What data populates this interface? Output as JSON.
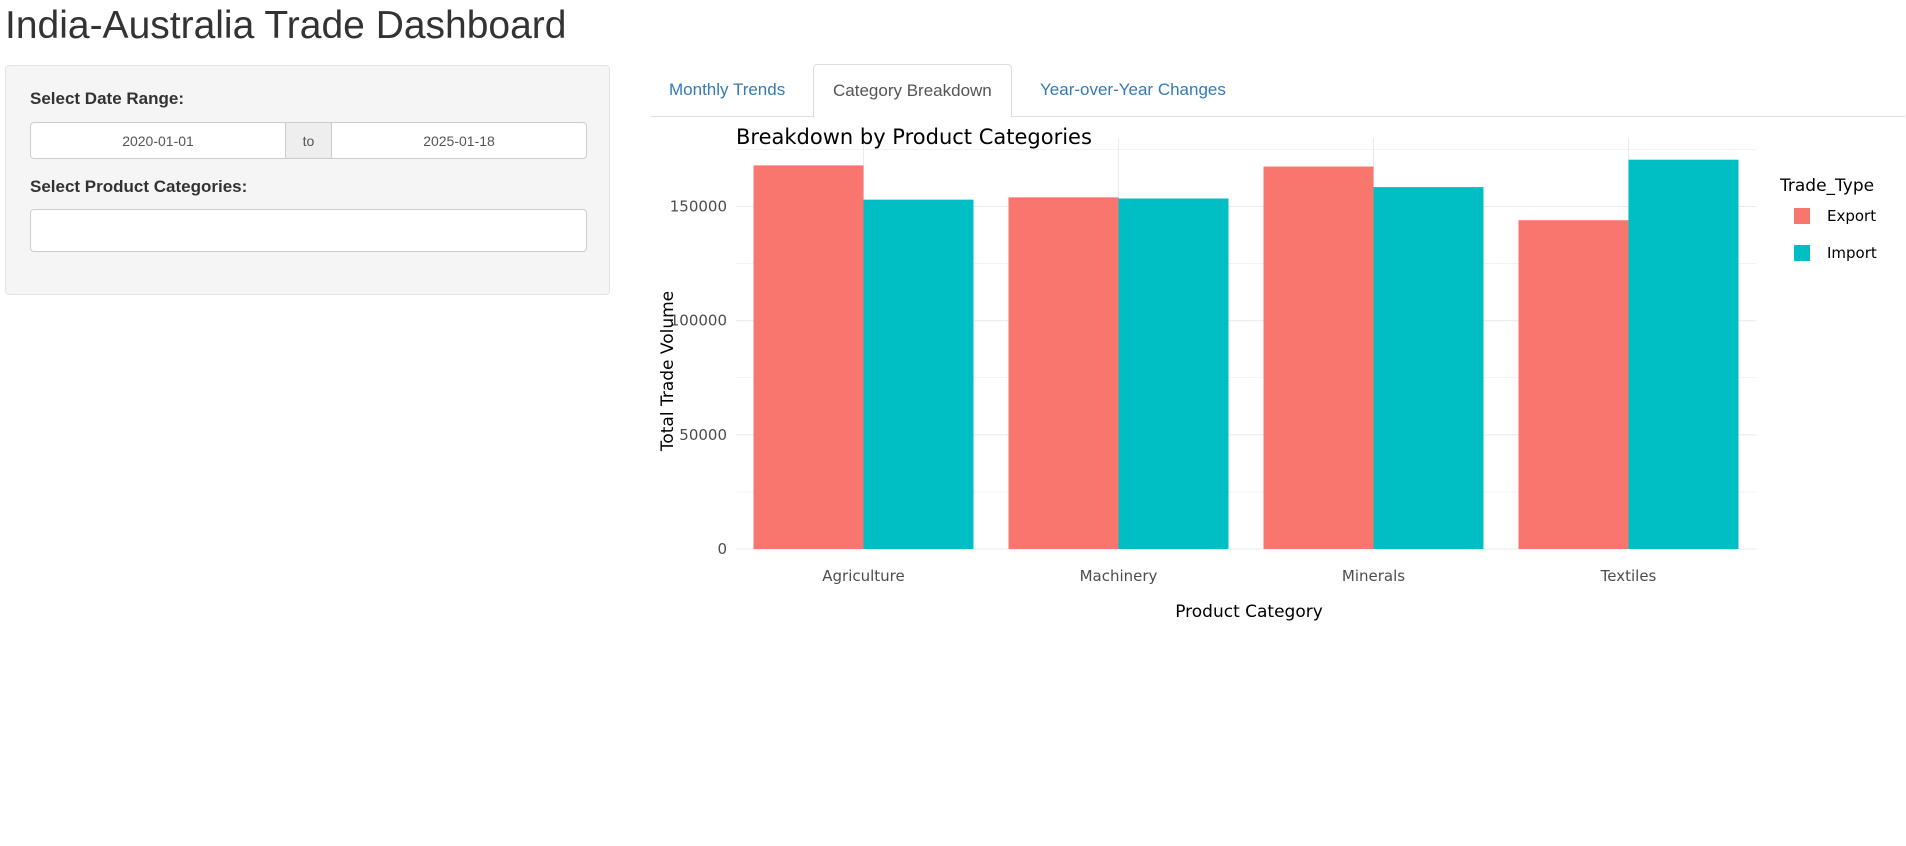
{
  "app": {
    "title": "India-Australia Trade Dashboard"
  },
  "sidebar": {
    "date_label": "Select Date Range:",
    "date_start": "2020-01-01",
    "date_sep": "to",
    "date_end": "2025-01-18",
    "category_label": "Select Product Categories:",
    "category_value": ""
  },
  "tabs": [
    {
      "label": "Monthly Trends",
      "active": false
    },
    {
      "label": "Category Breakdown",
      "active": true
    },
    {
      "label": "Year-over-Year Changes",
      "active": false
    }
  ],
  "colors": {
    "export": "#F8766D",
    "import": "#00BFC4",
    "link": "#337ab7"
  },
  "chart_data": {
    "type": "bar",
    "title": "Breakdown by Product Categories",
    "xlabel": "Product Category",
    "ylabel": "Total Trade Volume",
    "categories": [
      "Agriculture",
      "Machinery",
      "Minerals",
      "Textiles"
    ],
    "series": [
      {
        "name": "Export",
        "values": [
          168000,
          154000,
          167500,
          144000
        ]
      },
      {
        "name": "Import",
        "values": [
          153000,
          153500,
          158500,
          170500
        ]
      }
    ],
    "y_ticks": [
      0,
      50000,
      100000,
      150000
    ],
    "ylim": [
      0,
      180000
    ],
    "legend_title": "Trade_Type",
    "legend_position": "right",
    "grid": true
  }
}
